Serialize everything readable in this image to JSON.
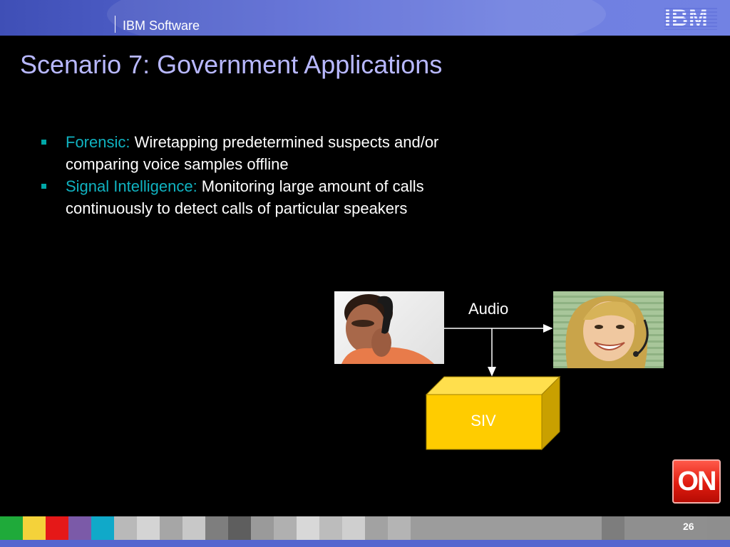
{
  "header": {
    "brand": "IBM Software",
    "logo": "IBM"
  },
  "slide": {
    "title": "Scenario 7: Government Applications",
    "bullets": [
      {
        "term": "Forensic:",
        "text": " Wiretapping predetermined suspects and/or comparing voice samples offline"
      },
      {
        "term": "Signal Intelligence:",
        "text": " Monitoring large amount of calls continuously to detect calls of particular speakers"
      }
    ]
  },
  "diagram": {
    "audio_label": "Audio",
    "siv_label": "SIV"
  },
  "on_badge": "ON",
  "footer": {
    "page_number": "26"
  },
  "colors": {
    "title": "#b8b8ff",
    "term": "#10b2c0",
    "siv_box": "#ffcc00",
    "header": "#5a6ad4",
    "on_badge": "#e01c10"
  }
}
